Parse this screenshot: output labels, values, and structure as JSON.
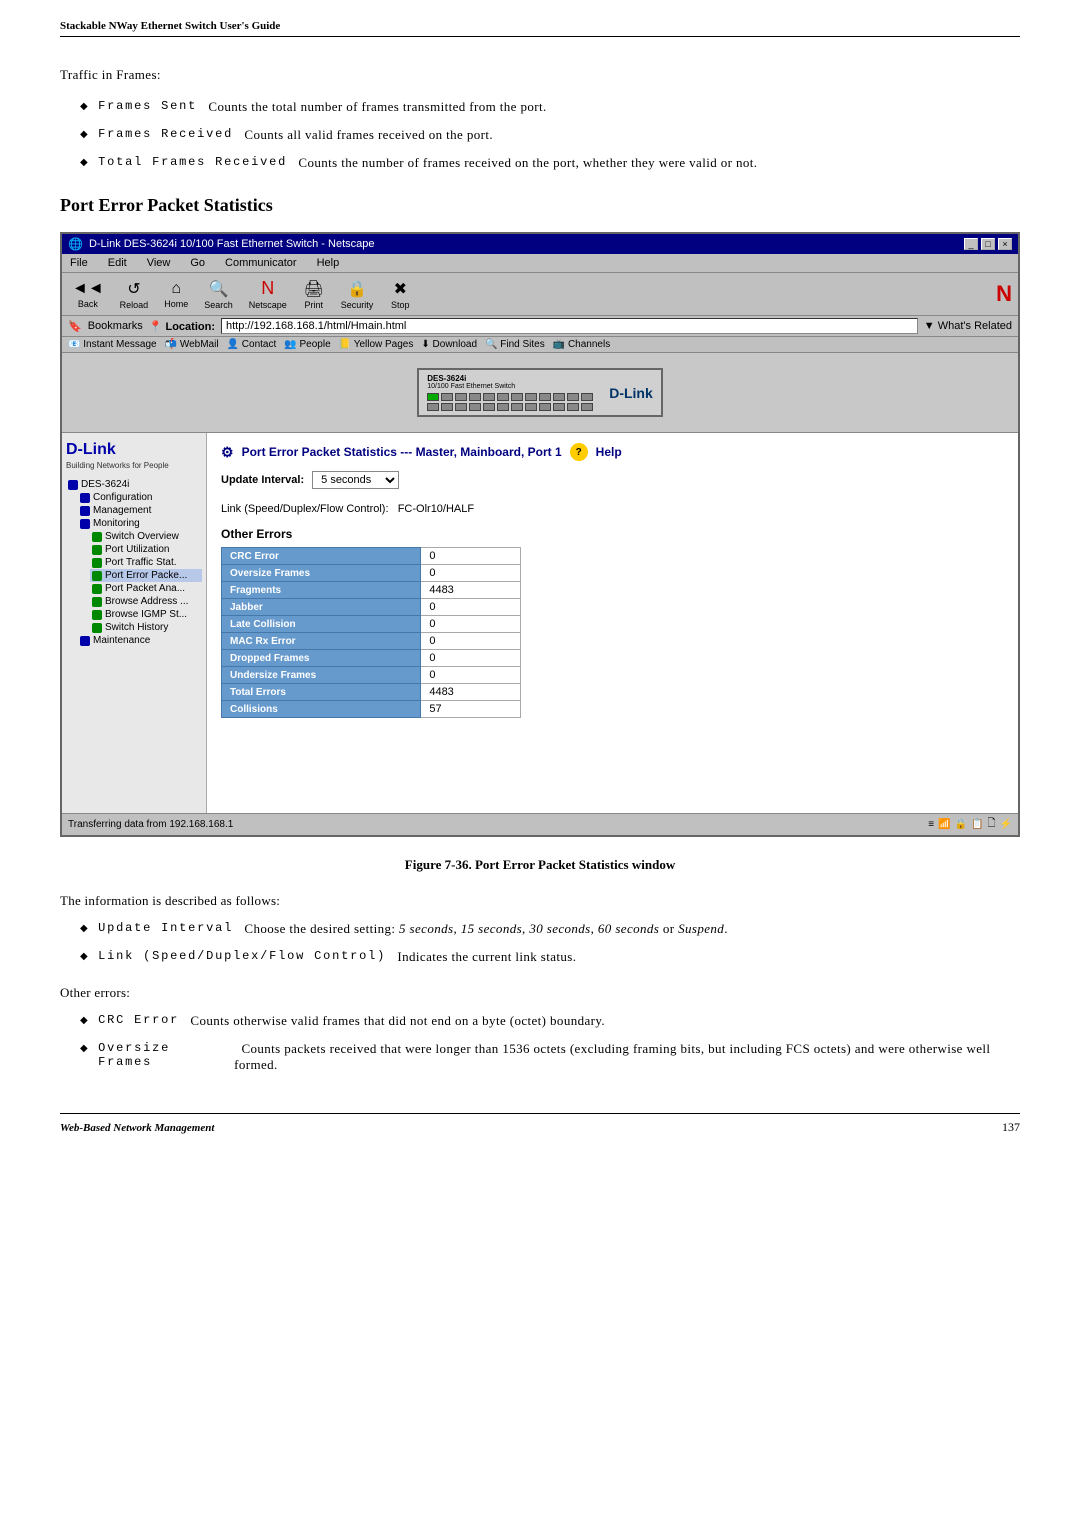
{
  "header": {
    "title": "Stackable NWay Ethernet Switch User's Guide"
  },
  "intro": {
    "traffic_label": "Traffic in Frames:",
    "bullets": [
      {
        "term": "Frames Sent",
        "description": "Counts the total number of frames transmitted from the port."
      },
      {
        "term": "Frames Received",
        "description": "Counts all valid frames received on the port."
      },
      {
        "term": "Total Frames Received",
        "description": "Counts the number of frames received on the port, whether they were valid or not."
      }
    ]
  },
  "section_heading": "Port Error Packet Statistics",
  "browser": {
    "title": "D-Link DES-3624i 10/100 Fast Ethernet Switch - Netscape",
    "controls": [
      "-",
      "□",
      "×"
    ],
    "menu": [
      "File",
      "Edit",
      "View",
      "Go",
      "Communicator",
      "Help"
    ],
    "toolbar_buttons": [
      {
        "label": "Back",
        "icon": "◄"
      },
      {
        "label": "Reload",
        "icon": "↺"
      },
      {
        "label": "Home",
        "icon": "⌂"
      },
      {
        "label": "Search",
        "icon": "🔍"
      },
      {
        "label": "Netscape",
        "icon": "N"
      },
      {
        "label": "Print",
        "icon": "🖨"
      },
      {
        "label": "Security",
        "icon": "🔒"
      },
      {
        "label": "Stop",
        "icon": "✖"
      }
    ],
    "location_label": "Location:",
    "location_url": "http://192.168.168.1/html/Hmain.html",
    "bookmarks": {
      "label": "Bookmarks",
      "items": [
        "Instant Message",
        "WebMail",
        "Contact",
        "People",
        "Yellow Pages",
        "Download",
        "Find Sites",
        "Channels"
      ]
    },
    "whats_related": "What's Related",
    "sidebar": {
      "logo": "D-Link",
      "tagline": "Building Networks for People",
      "items": [
        {
          "label": "DES-3624i",
          "indent": 0
        },
        {
          "label": "Configuration",
          "indent": 1
        },
        {
          "label": "Management",
          "indent": 1
        },
        {
          "label": "Monitoring",
          "indent": 1
        },
        {
          "label": "Switch Overview",
          "indent": 2,
          "icon": "green"
        },
        {
          "label": "Port Utilization",
          "indent": 2,
          "icon": "green"
        },
        {
          "label": "Port Traffic Stat.",
          "indent": 2,
          "icon": "green"
        },
        {
          "label": "Port Error Packe...",
          "indent": 2,
          "icon": "green"
        },
        {
          "label": "Port Packet Ana...",
          "indent": 2,
          "icon": "green"
        },
        {
          "label": "Browse Address ...",
          "indent": 2,
          "icon": "green"
        },
        {
          "label": "Browse IGMP St...",
          "indent": 2,
          "icon": "green"
        },
        {
          "label": "Switch History",
          "indent": 2,
          "icon": "green"
        },
        {
          "label": "Maintenance",
          "indent": 1
        }
      ]
    },
    "content": {
      "title": "Port Error Packet Statistics --- Master, Mainboard, Port 1",
      "help_label": "Help",
      "update_interval_label": "Update Interval:",
      "update_interval_value": "5 seconds",
      "update_interval_options": [
        "5 seconds",
        "15 seconds",
        "30 seconds",
        "60 seconds",
        "Suspend"
      ],
      "link_label": "Link (Speed/Duplex/Flow Control):",
      "link_value": "FC-Olr10/HALF",
      "other_errors_heading": "Other Errors",
      "errors": [
        {
          "label": "CRC Error",
          "value": "0"
        },
        {
          "label": "Oversize Frames",
          "value": "0"
        },
        {
          "label": "Fragments",
          "value": "4483"
        },
        {
          "label": "Jabber",
          "value": "0"
        },
        {
          "label": "Late Collision",
          "value": "0"
        },
        {
          "label": "MAC Rx Error",
          "value": "0"
        },
        {
          "label": "Dropped Frames",
          "value": "0"
        },
        {
          "label": "Undersize Frames",
          "value": "0"
        },
        {
          "label": "Total Errors",
          "value": "4483"
        },
        {
          "label": "Collisions",
          "value": "57"
        }
      ]
    },
    "status_bar": "Transferring data from 192.168.168.1"
  },
  "figure_caption": "Figure 7-36.  Port Error Packet Statistics window",
  "description": {
    "intro": "The information is described as follows:",
    "bullets": [
      {
        "term": "Update Interval",
        "description": "Choose the desired setting: 5 seconds, 15 seconds, 30 seconds, 60 seconds or Suspend."
      },
      {
        "term": "Link (Speed/Duplex/Flow Control)",
        "description": "Indicates the current link status."
      }
    ],
    "other_errors_label": "Other errors:",
    "error_bullets": [
      {
        "term": "CRC Error",
        "description": "Counts otherwise valid frames that did not end on a byte (octet) boundary."
      },
      {
        "term": "Oversize Frames",
        "description": "Counts packets received that were longer than 1536 octets (excluding framing bits, but including FCS octets) and were otherwise well formed."
      }
    ]
  },
  "footer": {
    "left": "Web-Based Network Management",
    "right": "137"
  }
}
